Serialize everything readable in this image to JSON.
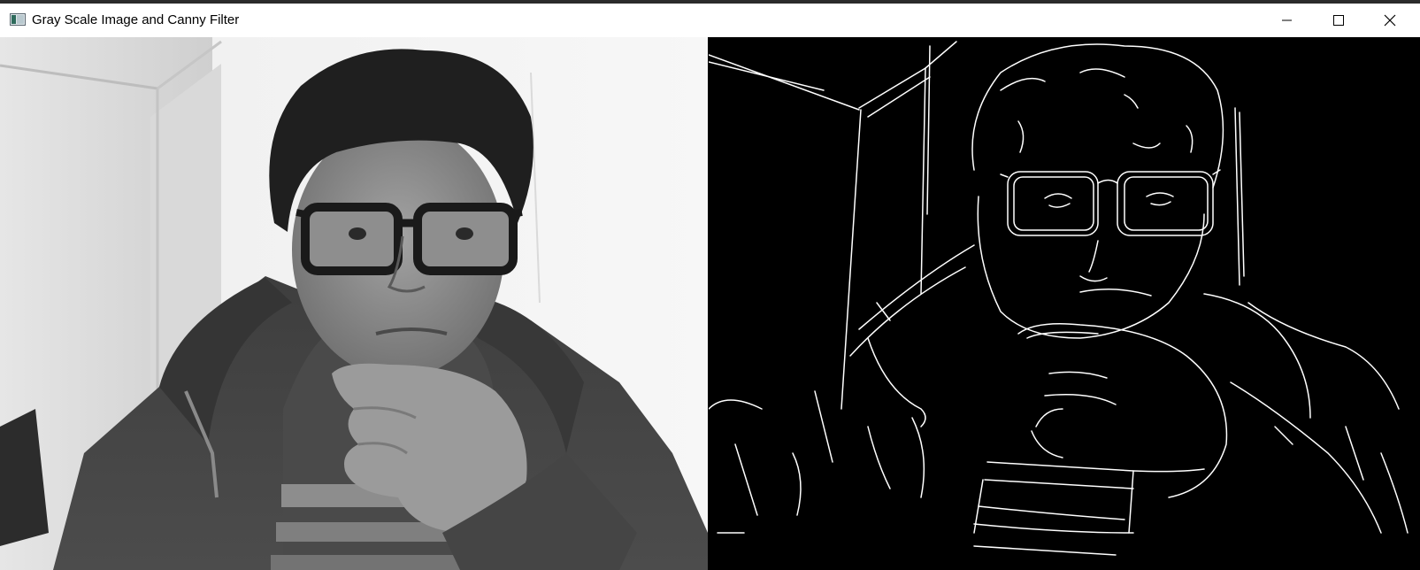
{
  "window": {
    "title": "Gray Scale Image and Canny Filter",
    "icon": "window-app-icon",
    "controls": {
      "minimize": "minimize-icon",
      "maximize": "maximize-icon",
      "close": "close-icon"
    }
  },
  "panes": [
    {
      "name": "grayscale-image",
      "content": "grayscale webcam frame"
    },
    {
      "name": "canny-edges-image",
      "content": "canny edge map"
    }
  ],
  "colors": {
    "titlebar": "#ffffff",
    "edges": "#ffffff",
    "canny_background": "#000000"
  }
}
